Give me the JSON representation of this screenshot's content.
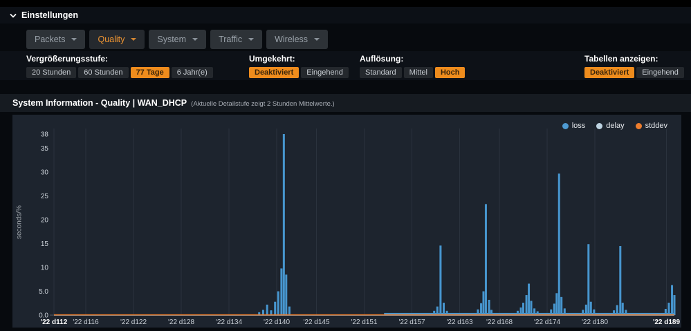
{
  "header": {
    "title": "Einstellungen"
  },
  "tabs": [
    {
      "label": "Packets",
      "active": false
    },
    {
      "label": "Quality",
      "active": true
    },
    {
      "label": "System",
      "active": false
    },
    {
      "label": "Traffic",
      "active": false
    },
    {
      "label": "Wireless",
      "active": false
    }
  ],
  "settings": {
    "groups": [
      {
        "label": "Vergrößerungsstufe:",
        "options": [
          {
            "label": "20 Stunden",
            "selected": false
          },
          {
            "label": "60 Stunden",
            "selected": false
          },
          {
            "label": "77 Tage",
            "selected": true
          },
          {
            "label": "6 Jahr(e)",
            "selected": false
          }
        ]
      },
      {
        "label": "Umgekehrt:",
        "options": [
          {
            "label": "Deaktiviert",
            "selected": true
          },
          {
            "label": "Eingehend",
            "selected": false
          }
        ]
      },
      {
        "label": "Auflösung:",
        "options": [
          {
            "label": "Standard",
            "selected": false
          },
          {
            "label": "Mittel",
            "selected": false
          },
          {
            "label": "Hoch",
            "selected": true
          }
        ]
      },
      {
        "label": "Tabellen anzeigen:",
        "options": [
          {
            "label": "Deaktiviert",
            "selected": true
          },
          {
            "label": "Eingehend",
            "selected": false
          }
        ]
      }
    ]
  },
  "panel": {
    "title": "System Information - Quality | WAN_DHCP",
    "note": "(Aktuelle Detailstufe zeigt 2 Stunden Mittelwerte.)"
  },
  "chart_data": {
    "type": "bar",
    "title": "System Information - Quality | WAN_DHCP",
    "xlabel": "",
    "ylabel": "seconds/%",
    "ylim": [
      0,
      38
    ],
    "xlim": [
      112,
      190
    ],
    "grid": "vertical",
    "legend": {
      "position": "top-right",
      "items": [
        {
          "name": "loss",
          "color": "#4e9ad2"
        },
        {
          "name": "delay",
          "color": "#bdd3e2"
        },
        {
          "name": "stddev",
          "color": "#ed7d2d"
        }
      ]
    },
    "y_ticks": [
      {
        "v": 0,
        "label": "0.0"
      },
      {
        "v": 5,
        "label": "5.0"
      },
      {
        "v": 10,
        "label": "10"
      },
      {
        "v": 15,
        "label": "15"
      },
      {
        "v": 20,
        "label": "20"
      },
      {
        "v": 25,
        "label": "25"
      },
      {
        "v": 30,
        "label": "30"
      },
      {
        "v": 35,
        "label": "35"
      },
      {
        "v": 38,
        "label": "38"
      }
    ],
    "x_ticks": [
      {
        "v": 112,
        "label": "'22 d112",
        "bold": true
      },
      {
        "v": 116,
        "label": "'22 d116",
        "bold": false
      },
      {
        "v": 122,
        "label": "'22 d122",
        "bold": false
      },
      {
        "v": 128,
        "label": "'22 d128",
        "bold": false
      },
      {
        "v": 134,
        "label": "'22 d134",
        "bold": false
      },
      {
        "v": 140,
        "label": "'22 d140",
        "bold": false
      },
      {
        "v": 145,
        "label": "'22 d145",
        "bold": false
      },
      {
        "v": 151,
        "label": "'22 d151",
        "bold": false
      },
      {
        "v": 157,
        "label": "'22 d157",
        "bold": false
      },
      {
        "v": 163,
        "label": "'22 d163",
        "bold": false
      },
      {
        "v": 168,
        "label": "'22 d168",
        "bold": false
      },
      {
        "v": 174,
        "label": "'22 d174",
        "bold": false
      },
      {
        "v": 180,
        "label": "'22 d180",
        "bold": false
      },
      {
        "v": 189,
        "label": "'22 d189",
        "bold": true
      }
    ],
    "series": [
      {
        "name": "loss",
        "type": "bars",
        "color": "#4796cf",
        "baseline": [
          {
            "from": 112,
            "to": 153.5,
            "v": 0.06
          },
          {
            "from": 153.5,
            "to": 190,
            "v": 0.45
          }
        ],
        "points": [
          [
            137.8,
            0.6
          ],
          [
            138.3,
            1.1
          ],
          [
            138.8,
            2.2
          ],
          [
            139.3,
            1.0
          ],
          [
            139.8,
            2.8
          ],
          [
            140.2,
            5.0
          ],
          [
            140.6,
            9.8
          ],
          [
            140.9,
            38
          ],
          [
            141.2,
            8.5
          ],
          [
            141.6,
            1.8
          ],
          [
            159.8,
            0.9
          ],
          [
            160.2,
            1.8
          ],
          [
            160.6,
            14.6
          ],
          [
            161.0,
            2.6
          ],
          [
            161.4,
            0.9
          ],
          [
            165.3,
            1.2
          ],
          [
            165.7,
            2.5
          ],
          [
            166.0,
            5.0
          ],
          [
            166.3,
            23.3
          ],
          [
            166.7,
            3.2
          ],
          [
            167.0,
            1.1
          ],
          [
            170.3,
            0.9
          ],
          [
            170.7,
            1.6
          ],
          [
            171.0,
            2.6
          ],
          [
            171.4,
            4.2
          ],
          [
            171.7,
            6.6
          ],
          [
            172.0,
            3.0
          ],
          [
            172.4,
            1.4
          ],
          [
            172.8,
            0.8
          ],
          [
            174.5,
            1.2
          ],
          [
            174.9,
            2.4
          ],
          [
            175.2,
            4.6
          ],
          [
            175.5,
            29.7
          ],
          [
            175.8,
            3.8
          ],
          [
            176.2,
            1.4
          ],
          [
            178.5,
            1.1
          ],
          [
            178.9,
            2.2
          ],
          [
            179.2,
            14.9
          ],
          [
            179.5,
            2.8
          ],
          [
            179.9,
            1.2
          ],
          [
            182.4,
            1.0
          ],
          [
            182.8,
            2.1
          ],
          [
            183.2,
            14.5
          ],
          [
            183.5,
            2.6
          ],
          [
            183.9,
            1.1
          ],
          [
            188.9,
            1.3
          ],
          [
            189.3,
            2.6
          ],
          [
            189.7,
            6.3
          ],
          [
            190.0,
            4.2
          ]
        ]
      },
      {
        "name": "delay",
        "type": "line",
        "color": "#bdd3e2",
        "points": [
          [
            112,
            0
          ],
          [
            190,
            0
          ]
        ]
      },
      {
        "name": "stddev",
        "type": "line",
        "color": "#ed7d2d",
        "points": [
          [
            112,
            0.05
          ],
          [
            190,
            0.05
          ]
        ]
      }
    ]
  }
}
